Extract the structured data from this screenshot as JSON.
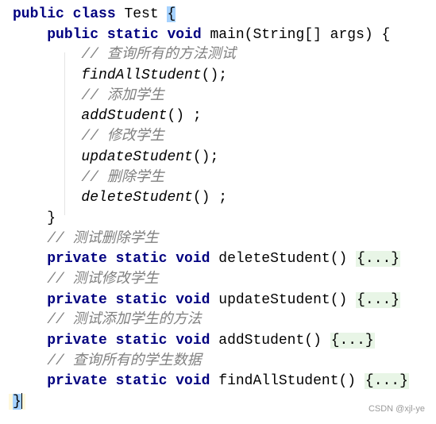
{
  "code": {
    "lines": [
      {
        "indent": 0,
        "tokens": [
          {
            "t": "kw",
            "v": "public class "
          },
          {
            "t": "plain",
            "v": "Test "
          },
          {
            "t": "brace-hl",
            "v": "{"
          }
        ]
      },
      {
        "indent": 1,
        "tokens": [
          {
            "t": "kw",
            "v": "public static void "
          },
          {
            "t": "plain",
            "v": "main(String[] args) {"
          }
        ]
      },
      {
        "indent": 2,
        "tokens": [
          {
            "t": "comment",
            "v": "// 查询所有的方法测试"
          }
        ]
      },
      {
        "indent": 2,
        "tokens": [
          {
            "t": "call",
            "v": "findAllStudent"
          },
          {
            "t": "plain",
            "v": "();"
          }
        ]
      },
      {
        "indent": 2,
        "tokens": [
          {
            "t": "comment",
            "v": "// 添加学生"
          }
        ]
      },
      {
        "indent": 2,
        "tokens": [
          {
            "t": "call",
            "v": "addStudent"
          },
          {
            "t": "plain",
            "v": "() ;"
          }
        ]
      },
      {
        "indent": 2,
        "tokens": [
          {
            "t": "comment",
            "v": "// 修改学生"
          }
        ]
      },
      {
        "indent": 2,
        "tokens": [
          {
            "t": "call",
            "v": "updateStudent"
          },
          {
            "t": "plain",
            "v": "();"
          }
        ]
      },
      {
        "indent": 2,
        "tokens": [
          {
            "t": "comment",
            "v": "// 删除学生"
          }
        ]
      },
      {
        "indent": 2,
        "tokens": [
          {
            "t": "call",
            "v": "deleteStudent"
          },
          {
            "t": "plain",
            "v": "() ;"
          }
        ]
      },
      {
        "indent": 1,
        "tokens": [
          {
            "t": "plain",
            "v": "}"
          }
        ]
      },
      {
        "indent": 1,
        "tokens": [
          {
            "t": "comment",
            "v": "// 测试删除学生"
          }
        ]
      },
      {
        "indent": 1,
        "tokens": [
          {
            "t": "kw",
            "v": "private static void "
          },
          {
            "t": "plain",
            "v": "deleteStudent() "
          },
          {
            "t": "fold",
            "v": "{...}"
          }
        ]
      },
      {
        "indent": 1,
        "tokens": [
          {
            "t": "comment",
            "v": "// 测试修改学生"
          }
        ]
      },
      {
        "indent": 1,
        "tokens": [
          {
            "t": "kw",
            "v": "private static void "
          },
          {
            "t": "plain",
            "v": "updateStudent() "
          },
          {
            "t": "fold",
            "v": "{...}"
          }
        ]
      },
      {
        "indent": 1,
        "tokens": [
          {
            "t": "comment",
            "v": "// 测试添加学生的方法"
          }
        ]
      },
      {
        "indent": 1,
        "tokens": [
          {
            "t": "kw",
            "v": "private static void "
          },
          {
            "t": "plain",
            "v": "addStudent() "
          },
          {
            "t": "fold",
            "v": "{...}"
          }
        ]
      },
      {
        "indent": 1,
        "tokens": [
          {
            "t": "comment",
            "v": "// 查询所有的学生数据"
          }
        ]
      },
      {
        "indent": 1,
        "tokens": [
          {
            "t": "kw",
            "v": "private static void "
          },
          {
            "t": "plain",
            "v": "findAllStudent() "
          },
          {
            "t": "fold",
            "v": "{...}"
          }
        ]
      },
      {
        "indent": 0,
        "tokens": [
          {
            "t": "brace-end",
            "v": "}"
          }
        ]
      }
    ]
  },
  "watermark": "CSDN @xjl-ye",
  "colors": {
    "keyword": "#000080",
    "comment": "#808080",
    "fold_bg": "#e8f5e6",
    "brace_match": "#a6d2ff"
  }
}
